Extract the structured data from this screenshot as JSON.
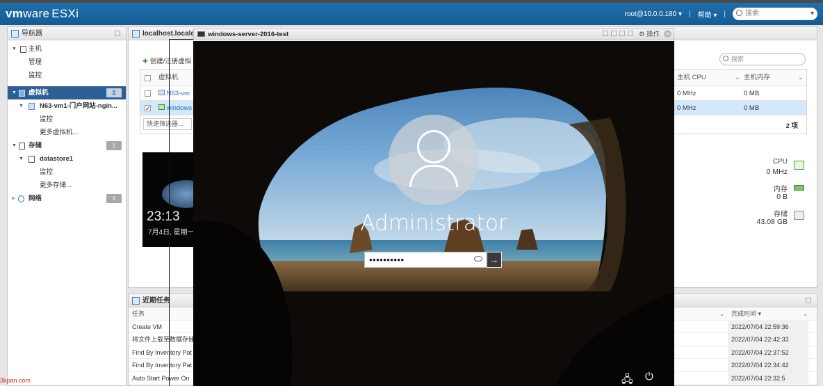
{
  "topbar": {
    "logo_vm": "vm",
    "logo_ware": "ware",
    "logo_product": "ESXi",
    "user": "root@10.0.0.180 ▾",
    "help": "帮助 ▾",
    "search_placeholder": "搜索"
  },
  "navigator": {
    "title": "导航器",
    "items": [
      {
        "label": "主机"
      },
      {
        "label": "管理"
      },
      {
        "label": "监控"
      },
      {
        "label": "虚拟机",
        "badge": "2"
      },
      {
        "label": "N63-vm1-门户网站-ngin..."
      },
      {
        "label": "监控"
      },
      {
        "label": "更多虚拟机..."
      },
      {
        "label": "存储",
        "badge": "1"
      },
      {
        "label": "datastore1"
      },
      {
        "label": "监控"
      },
      {
        "label": "更多存储..."
      },
      {
        "label": "网络",
        "badge": "1"
      }
    ]
  },
  "main": {
    "tab_title": "localhost.localdo",
    "toolbar_create": "创建/注册虚拟",
    "search_placeholder": "搜索",
    "columns": {
      "vm": "虚拟机",
      "host_cpu": "主机 CPU",
      "host_mem": "主机内存"
    },
    "rows": [
      {
        "name": "N63-vm",
        "cpu": "0 MHz",
        "mem": "0 MB",
        "selected": false
      },
      {
        "name": "windows",
        "cpu": "0 MHz",
        "mem": "0 MB",
        "selected": true
      }
    ],
    "filter_placeholder": "快速筛选器...",
    "count": "2 项",
    "thumb_time": "23:13",
    "thumb_date": "7月4日, 星期一",
    "resources": [
      {
        "name": "CPU",
        "value": "0 MHz"
      },
      {
        "name": "内存",
        "value": "0 B"
      },
      {
        "name": "存储",
        "value": "43.08 GB"
      }
    ]
  },
  "tasks": {
    "title": "近期任务",
    "col_task": "任务",
    "col_completed": "完成时间 ▾",
    "rows": [
      {
        "task": "Create VM",
        "time": "2022/07/04 22:59:36"
      },
      {
        "task": "将文件上载至数据存储",
        "time": "2022/07/04 22:42:33"
      },
      {
        "task": "Find By Inventory Pat",
        "time": "2022/07/04 22:37:52"
      },
      {
        "task": "Find By Inventory Pat",
        "time": "2022/07/04 22:34:42"
      },
      {
        "task": "Auto Start Power On",
        "time": "2022/07/04 22:32:5"
      }
    ]
  },
  "console": {
    "title": "windows-server-2016-test",
    "actions_label": "操作",
    "username": "Administrator",
    "password_mask": "••••••••••"
  },
  "watermark": "3kpan.com"
}
